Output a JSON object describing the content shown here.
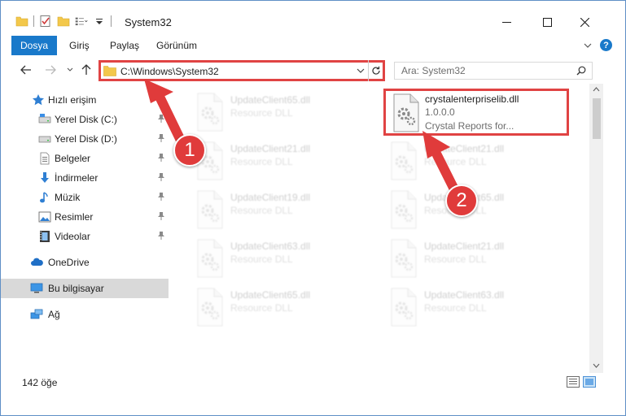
{
  "window": {
    "title": "System32",
    "minimize_glyph": "—",
    "maximize_glyph": "☐",
    "close_glyph": "✕"
  },
  "ribbon": {
    "tabs": [
      {
        "label": "Dosya"
      },
      {
        "label": "Giriş"
      },
      {
        "label": "Paylaş"
      },
      {
        "label": "Görünüm"
      }
    ],
    "help_glyph": "?"
  },
  "nav": {
    "address": "C:\\Windows\\System32",
    "search_placeholder": "Ara: System32"
  },
  "sidebar": {
    "quick_access": "Hızlı erişim",
    "items": [
      {
        "label": "Yerel Disk (C:)",
        "icon": "drive-icon",
        "pinned": true
      },
      {
        "label": "Yerel Disk (D:)",
        "icon": "drive-icon",
        "pinned": true
      },
      {
        "label": "Belgeler",
        "icon": "documents-icon",
        "pinned": true
      },
      {
        "label": "İndirmeler",
        "icon": "download-icon",
        "pinned": true
      },
      {
        "label": "Müzik",
        "icon": "music-icon",
        "pinned": true
      },
      {
        "label": "Resimler",
        "icon": "pictures-icon",
        "pinned": true
      },
      {
        "label": "Videolar",
        "icon": "video-icon",
        "pinned": true
      }
    ],
    "onedrive": "OneDrive",
    "this_pc": "Bu bilgisayar",
    "network": "Ağ"
  },
  "files": {
    "left_column": [
      {
        "name": "UpdateClient65.dll",
        "type": "Resource DLL"
      },
      {
        "name": "UpdateClient21.dll",
        "type": "Resource DLL"
      },
      {
        "name": "UpdateClient19.dll",
        "type": "Resource DLL"
      },
      {
        "name": "UpdateClient63.dll",
        "type": "Resource DLL"
      },
      {
        "name": "UpdateClient65.dll",
        "type": "Resource DLL"
      }
    ],
    "highlighted": {
      "name": "crystalenterpriselib.dll",
      "version": "1.0.0.0",
      "description": "Crystal Reports for..."
    },
    "right_column": [
      {
        "name": "UpdateClient21.dll",
        "type": "Resource DLL"
      },
      {
        "name": "UpdateClient65.dll",
        "type": "Resource DLL"
      },
      {
        "name": "UpdateClient21.dll",
        "type": "Resource DLL"
      },
      {
        "name": "UpdateClient63.dll",
        "type": "Resource DLL"
      }
    ]
  },
  "status": {
    "item_count": "142 öğe"
  },
  "annotations": {
    "step1": "1",
    "step2": "2",
    "color": "#e03b3b"
  }
}
